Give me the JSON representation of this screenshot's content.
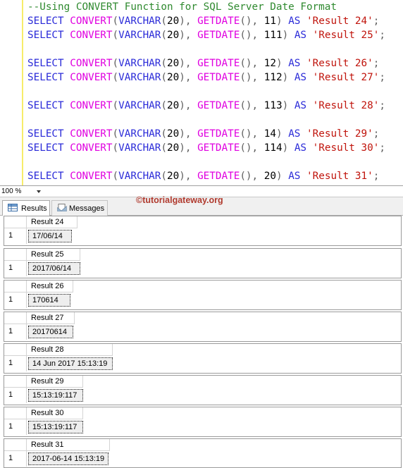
{
  "editor": {
    "comment": "--Using CONVERT Function for SQL Server Date Format",
    "lines": [
      {
        "keyword": "SELECT",
        "func": "CONVERT",
        "type": "VARCHAR",
        "len": "20",
        "date_func": "GETDATE",
        "style": "11",
        "as": "AS",
        "alias": "'Result 24'",
        "end": ";"
      },
      {
        "keyword": "SELECT",
        "func": "CONVERT",
        "type": "VARCHAR",
        "len": "20",
        "date_func": "GETDATE",
        "style": "111",
        "as": "AS",
        "alias": "'Result 25'",
        "end": ";"
      },
      {
        "keyword": "SELECT",
        "func": "CONVERT",
        "type": "VARCHAR",
        "len": "20",
        "date_func": "GETDATE",
        "style": "12",
        "as": "AS",
        "alias": "'Result 26'",
        "end": ";"
      },
      {
        "keyword": "SELECT",
        "func": "CONVERT",
        "type": "VARCHAR",
        "len": "20",
        "date_func": "GETDATE",
        "style": "112",
        "as": "AS",
        "alias": "'Result 27'",
        "end": ";"
      },
      {
        "keyword": "SELECT",
        "func": "CONVERT",
        "type": "VARCHAR",
        "len": "20",
        "date_func": "GETDATE",
        "style": "113",
        "as": "AS",
        "alias": "'Result 28'",
        "end": ";"
      },
      {
        "keyword": "SELECT",
        "func": "CONVERT",
        "type": "VARCHAR",
        "len": "20",
        "date_func": "GETDATE",
        "style": "14",
        "as": "AS",
        "alias": "'Result 29'",
        "end": ";"
      },
      {
        "keyword": "SELECT",
        "func": "CONVERT",
        "type": "VARCHAR",
        "len": "20",
        "date_func": "GETDATE",
        "style": "114",
        "as": "AS",
        "alias": "'Result 30'",
        "end": ";"
      },
      {
        "keyword": "SELECT",
        "func": "CONVERT",
        "type": "VARCHAR",
        "len": "20",
        "date_func": "GETDATE",
        "style": "20",
        "as": "AS",
        "alias": "'Result 31'",
        "end": ";"
      }
    ]
  },
  "zoom": {
    "value": "100 %"
  },
  "tabs": {
    "results_label": "Results",
    "messages_label": "Messages"
  },
  "watermark": "©tutorialgateway.org",
  "results": [
    {
      "header": "Result 24",
      "row": "1",
      "value": "17/06/14"
    },
    {
      "header": "Result 25",
      "row": "1",
      "value": "2017/06/14"
    },
    {
      "header": "Result 26",
      "row": "1",
      "value": "170614"
    },
    {
      "header": "Result 27",
      "row": "1",
      "value": "20170614"
    },
    {
      "header": "Result 28",
      "row": "1",
      "value": "14 Jun 2017 15:13:19"
    },
    {
      "header": "Result 29",
      "row": "1",
      "value": "15:13:19:117"
    },
    {
      "header": "Result 30",
      "row": "1",
      "value": "15:13:19:117"
    },
    {
      "header": "Result 31",
      "row": "1",
      "value": "2017-06-14 15:13:19"
    }
  ],
  "colors": {
    "keyword": "#2a2ad8",
    "function": "#e000e0",
    "string": "#c0140c",
    "comment": "#2f8a2f",
    "watermark": "#b03a2e"
  }
}
